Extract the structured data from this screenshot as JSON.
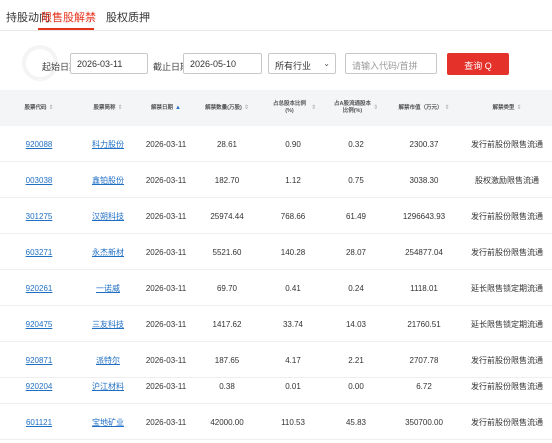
{
  "tabs": [
    {
      "label": "持股动向",
      "active": false
    },
    {
      "label": "限售股解禁",
      "active": true
    },
    {
      "label": "股权质押",
      "active": false
    }
  ],
  "filter": {
    "start_label": "起始日期：",
    "start_value": "2026-03-11",
    "end_label": "截止日期：",
    "end_value": "2026-05-10",
    "industry_value": "所有行业",
    "search_placeholder": "请输入代码/首拼",
    "search_button": "查询 Q"
  },
  "table": {
    "headers": [
      "股票代码",
      "股票简称",
      "解禁日期",
      "解禁数量(万股)",
      "占总股本比例(%)",
      "占A股流通股本比例(%)",
      "解禁市值（万元）",
      "解禁类型"
    ],
    "sort_glyph": "⇕",
    "sort_active_glyph": "▲",
    "rows": [
      [
        "920088",
        "科力股份",
        "2026-03-11",
        "28.61",
        "0.90",
        "0.32",
        "2300.37",
        "发行前股份限售流通"
      ],
      [
        "003038",
        "鑫铂股份",
        "2026-03-11",
        "182.70",
        "1.12",
        "0.75",
        "3038.30",
        "股权激励限售流通"
      ],
      [
        "301275",
        "汉朔科技",
        "2026-03-11",
        "25974.44",
        "768.66",
        "61.49",
        "1296643.93",
        "发行前股份限售流通"
      ],
      [
        "603271",
        "永杰新材",
        "2026-03-11",
        "5521.60",
        "140.28",
        "28.07",
        "254877.04",
        "发行前股份限售流通"
      ],
      [
        "920261",
        "一诺威",
        "2026-03-11",
        "69.70",
        "0.41",
        "0.24",
        "1118.01",
        "延长限售锁定期流通"
      ],
      [
        "920475",
        "三友科技",
        "2026-03-11",
        "1417.62",
        "33.74",
        "14.03",
        "21760.51",
        "延长限售锁定期流通"
      ],
      [
        "920871",
        "派特尔",
        "2026-03-11",
        "187.65",
        "4.17",
        "2.21",
        "2707.78",
        "发行前股份限售流通"
      ],
      [
        "920204",
        "沪江材料",
        "2026-03-11",
        "0.38",
        "0.01",
        "0.00",
        "6.72",
        "发行前股份限售流通"
      ],
      [
        "601121",
        "宝地矿业",
        "2026-03-11",
        "42000.00",
        "110.53",
        "45.83",
        "350700.00",
        "发行前股份限售流通"
      ]
    ]
  },
  "colors": {
    "accent": "#e5331b",
    "link": "#1f6fc4",
    "header_bg": "#f4f5f7"
  }
}
